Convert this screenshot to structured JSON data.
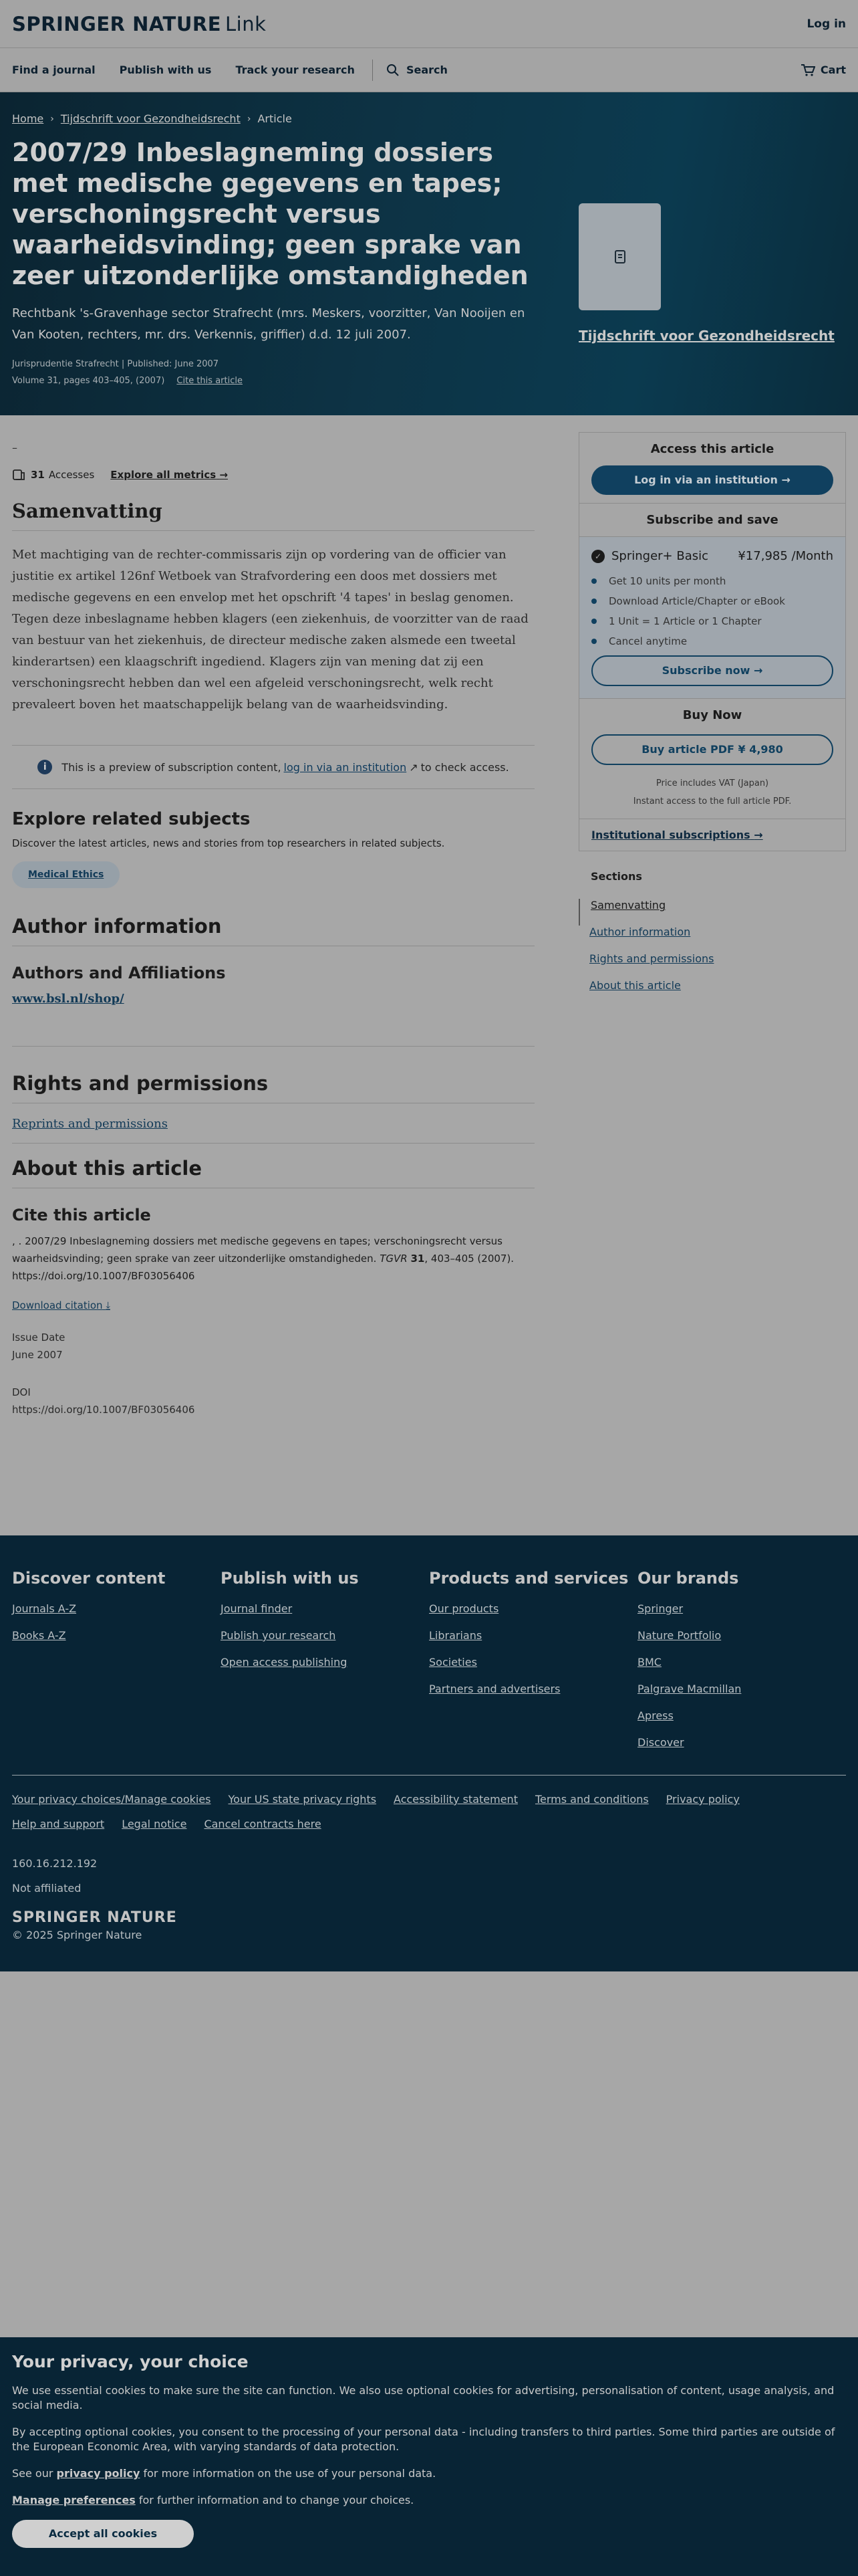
{
  "header": {
    "brand_main": "SPRINGER NATURE",
    "brand_link": "Link",
    "login": "Log in",
    "nav": [
      "Find a journal",
      "Publish with us",
      "Track your research"
    ],
    "search": "Search",
    "cart": "Cart"
  },
  "hero": {
    "breadcrumb": [
      "Home",
      "Tijdschrift voor Gezondheidsrecht",
      "Article"
    ],
    "title": "2007/29 Inbeslagneming dossiers met medische gegevens en tapes; verschoningsrecht versus waarheidsvinding; geen sprake van zeer uitzonderlijke omstandigheden",
    "subtitle": "Rechtbank 's-Gravenhage sector Strafrecht (mrs. Meskers, voorzitter, Van Nooijen en Van Kooten, rechters, mr. drs. Verkennis, griffier) d.d. 12 juli 2007.",
    "meta_type": "Jurisprudentie Strafrecht",
    "meta_published": "Published: June 2007",
    "meta_volume": "Volume 31, pages 403–405, (2007)",
    "cite_link": "Cite this article",
    "journal_name": "Tijdschrift voor Gezondheidsrecht"
  },
  "main": {
    "dash": "–",
    "accesses_count": "31",
    "accesses_label": "Accesses",
    "explore_metrics": "Explore all metrics",
    "abstract_heading": "Samenvatting",
    "abstract_text": "Met machtiging van de rechter-commissaris zijn op vordering van de officier van justitie ex artikel 126nf Wetboek van Strafvordering een doos met dossiers met medische gegevens en een envelop met het opschrift '4 tapes' in beslag genomen. Tegen deze inbeslagname hebben klagers (een ziekenhuis, de voorzitter van de raad van bestuur van het ziekenhuis, de directeur medische zaken alsmede een tweetal kinderartsen) een klaagschrift ingediend. Klagers zijn van mening dat zij een verschoningsrecht hebben dan wel een afgeleid verschoningsrecht, welk recht prevaleert boven het maatschappelijk belang van de waarheidsvinding.",
    "preview_before": "This is a preview of subscription content,",
    "preview_link": "log in via an institution",
    "preview_after": "to check access.",
    "related_heading": "Explore related subjects",
    "related_desc": "Discover the latest articles, news and stories from top researchers in related subjects.",
    "related_tag": "Medical Ethics",
    "author_heading": "Author information",
    "affil_heading": "Authors and Affiliations",
    "affil_link": "www.bsl.nl/shop/",
    "rights_heading": "Rights and permissions",
    "rights_link": "Reprints and permissions",
    "about_heading": "About this article",
    "cite_heading": "Cite this article",
    "citation_text": ", . 2007/29 Inbeslagneming dossiers met medische gegevens en tapes; verschoningsrecht versus waarheidsvinding; geen sprake van zeer uitzonderlijke omstandigheden.",
    "citation_journal": "TGVR",
    "citation_volume": "31",
    "citation_pages": ", 403–405 (2007). https://doi.org/10.1007/BF03056406",
    "download_citation": "Download citation",
    "issue_label": "Issue Date",
    "issue_value": "June 2007",
    "doi_label": "DOI",
    "doi_value": "https://doi.org/10.1007/BF03056406"
  },
  "sidebar": {
    "access_heading": "Access this article",
    "login_institution": "Log in via an institution",
    "subscribe_heading": "Subscribe and save",
    "plan_name": "Springer+ Basic",
    "plan_price": "¥17,985 /Month",
    "plan_features": [
      "Get 10 units per month",
      "Download Article/Chapter or eBook",
      "1 Unit = 1 Article or 1 Chapter",
      "Cancel anytime"
    ],
    "subscribe_now": "Subscribe now",
    "buy_heading": "Buy Now",
    "buy_pdf": "Buy article PDF ¥ 4,980",
    "vat_note": "Price includes VAT (Japan)",
    "instant_note": "Instant access to the full article PDF.",
    "institutional": "Institutional subscriptions",
    "sections_title": "Sections",
    "sections": [
      "Samenvatting",
      "Author information",
      "Rights and permissions",
      "About this article"
    ]
  },
  "footer": {
    "columns": [
      {
        "title": "Discover content",
        "links": [
          "Journals A-Z",
          "Books A-Z"
        ]
      },
      {
        "title": "Publish with us",
        "links": [
          "Journal finder",
          "Publish your research",
          "Open access publishing"
        ]
      },
      {
        "title": "Products and services",
        "links": [
          "Our products",
          "Librarians",
          "Societies",
          "Partners and advertisers"
        ]
      },
      {
        "title": "Our brands",
        "links": [
          "Springer",
          "Nature Portfolio",
          "BMC",
          "Palgrave Macmillan",
          "Apress",
          "Discover"
        ]
      }
    ],
    "legal": [
      "Your privacy choices/Manage cookies",
      "Your US state privacy rights",
      "Accessibility statement",
      "Terms and conditions",
      "Privacy policy",
      "Help and support",
      "Legal notice",
      "Cancel contracts here"
    ],
    "ip": "160.16.212.192",
    "affiliation": "Not affiliated",
    "brand": "SPRINGER NATURE",
    "copyright": "© 2025 Springer Nature"
  },
  "cookie": {
    "title": "Your privacy, your choice",
    "p1": "We use essential cookies to make sure the site can function. We also use optional cookies for advertising, personalisation of content, usage analysis, and social media.",
    "p2": "By accepting optional cookies, you consent to the processing of your personal data - including transfers to third parties. Some third parties are outside of the European Economic Area, with varying standards of data protection.",
    "p3_before": "See our",
    "p3_link": "privacy policy",
    "p3_after": "for more information on the use of your personal data.",
    "p4_link": "Manage preferences",
    "p4_after": "for further information and to change your choices.",
    "accept": "Accept all cookies"
  },
  "colors": {
    "hero_bg": "#0d3345",
    "footer_bg": "#082435",
    "accent": "#10405f"
  }
}
